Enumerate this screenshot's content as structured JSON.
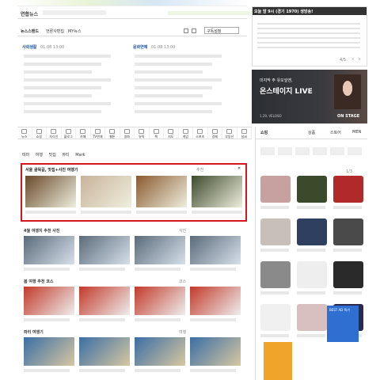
{
  "top_banner": {
    "brand": "연합뉴스"
  },
  "news_bar": {
    "item1": "뉴스스탠드",
    "item2": "언론사편집",
    "item3": "MY뉴스",
    "dropdown": "구독설정"
  },
  "news_left": {
    "heading": "사회생활",
    "time": "01.08 13:00"
  },
  "news_right": {
    "heading": "문화연예",
    "time": "01.08 13:00"
  },
  "news_left_lines": [
    "",
    "",
    "",
    "",
    "",
    "",
    "",
    ""
  ],
  "news_right_lines": [
    "",
    "",
    "",
    "",
    "",
    "",
    "",
    ""
  ],
  "weather": {
    "title": "오늘 밤 9시 (경기 1970) 생방송!",
    "page": "4/5"
  },
  "live_ad": {
    "line1": "미지막 주 유오잎엔,",
    "line2": "온스테이지 LIVE",
    "date": "1.29, VELOSO",
    "badge": "ON STAGE"
  },
  "cat_tabs": [
    "뉴스",
    "쇼핑",
    "지식인",
    "블로그",
    "카페",
    "TV연재",
    "웹툰",
    "영화",
    "뮤직",
    "책",
    "지도",
    "게임",
    "스포츠",
    "경제",
    "부동산",
    "날씨"
  ],
  "sub_tabs": {
    "t1": "테마",
    "t2": "여행",
    "t3": "맛집",
    "t4": "뷰티",
    "t5": "Mark"
  },
  "featured": {
    "title": "서울 골목길, 맛집+사진 여행기",
    "sub": "추천",
    "page": "1"
  },
  "featured_captions": [
    "",
    "",
    "",
    ""
  ],
  "sections": [
    {
      "title": "4월 여행지 추천 사진",
      "sub": "사진"
    },
    {
      "title": "봄 여행 추천 코스",
      "sub": "코스"
    },
    {
      "title": "파리 여행기",
      "sub": "여행"
    }
  ],
  "shop": {
    "title": "쇼핑",
    "tabs": [
      "상품",
      "스토어",
      "MEN"
    ],
    "page": "1/3",
    "sale": "BEST AD 특가"
  }
}
